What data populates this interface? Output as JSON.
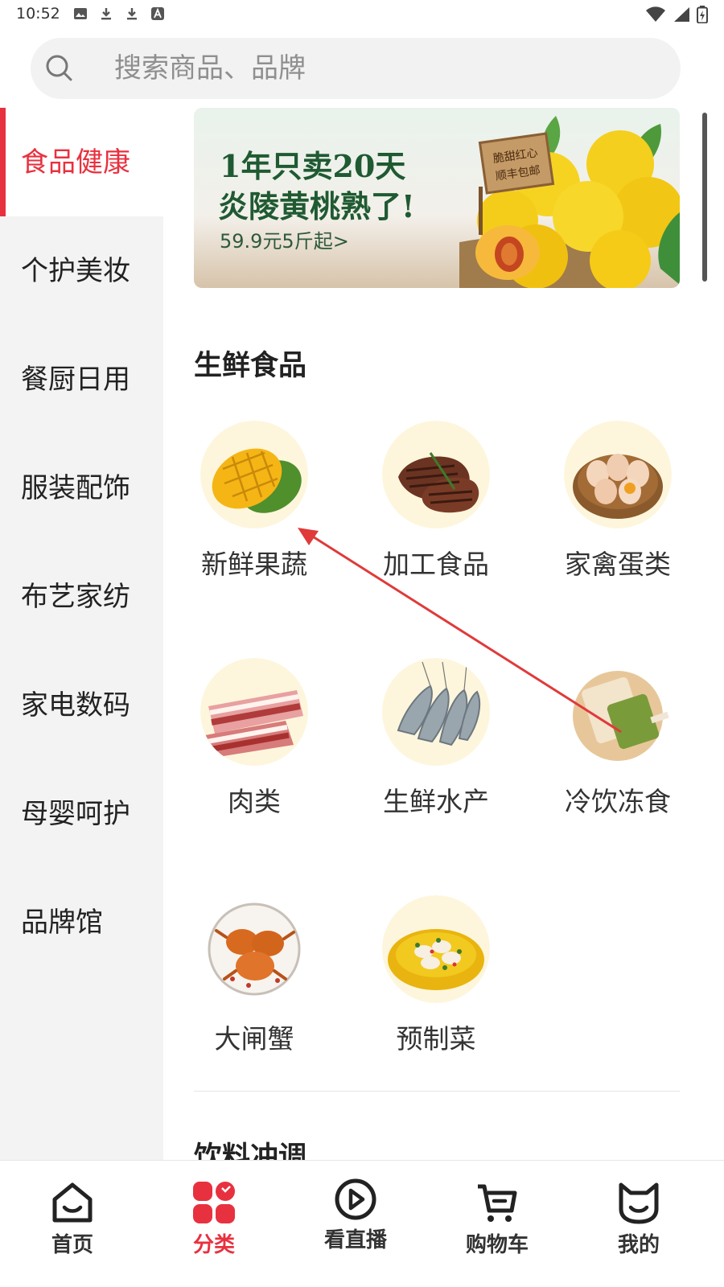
{
  "status_bar": {
    "time": "10:52",
    "icons": [
      "image-icon",
      "download-icon",
      "download-icon",
      "font-icon",
      "wifi-icon",
      "signal-icon",
      "battery-icon"
    ]
  },
  "search": {
    "placeholder": "搜索商品、品牌"
  },
  "sidebar": {
    "items": [
      {
        "label": "食品健康",
        "active": true
      },
      {
        "label": "个护美妆",
        "active": false
      },
      {
        "label": "餐厨日用",
        "active": false
      },
      {
        "label": "服装配饰",
        "active": false
      },
      {
        "label": "布艺家纺",
        "active": false
      },
      {
        "label": "家电数码",
        "active": false
      },
      {
        "label": "母婴呵护",
        "active": false
      },
      {
        "label": "品牌馆",
        "active": false
      }
    ]
  },
  "banner": {
    "line1": "1年只卖20天",
    "line2": "炎陵黄桃熟了!",
    "line3": "59.9元5斤起>",
    "sign_line1": "脆甜红心",
    "sign_line2": "顺丰包邮"
  },
  "section": {
    "title": "生鲜食品",
    "categories": [
      {
        "name": "新鲜果蔬",
        "icon": "mango-icon"
      },
      {
        "name": "加工食品",
        "icon": "steak-icon"
      },
      {
        "name": "家禽蛋类",
        "icon": "eggs-icon"
      },
      {
        "name": "肉类",
        "icon": "pork-belly-icon"
      },
      {
        "name": "生鲜水产",
        "icon": "shrimp-icon"
      },
      {
        "name": "冷饮冻食",
        "icon": "ice-pop-icon"
      },
      {
        "name": "大闸蟹",
        "icon": "crab-icon"
      },
      {
        "name": "预制菜",
        "icon": "prepared-dish-icon"
      }
    ]
  },
  "next_section": {
    "title": "饮料冲调"
  },
  "bottom_nav": {
    "items": [
      {
        "label": "首页",
        "icon": "home-icon",
        "active": false
      },
      {
        "label": "分类",
        "icon": "category-icon",
        "active": true
      },
      {
        "label": "看直播",
        "icon": "live-play-icon",
        "active": false
      },
      {
        "label": "购物车",
        "icon": "cart-icon",
        "active": false
      },
      {
        "label": "我的",
        "icon": "profile-cat-icon",
        "active": false
      }
    ]
  },
  "colors": {
    "accent": "#e8313f",
    "sidebar_bg": "#f3f3f3",
    "search_bg": "#f2f2f2",
    "annotation_arrow": "#e03a3a"
  }
}
